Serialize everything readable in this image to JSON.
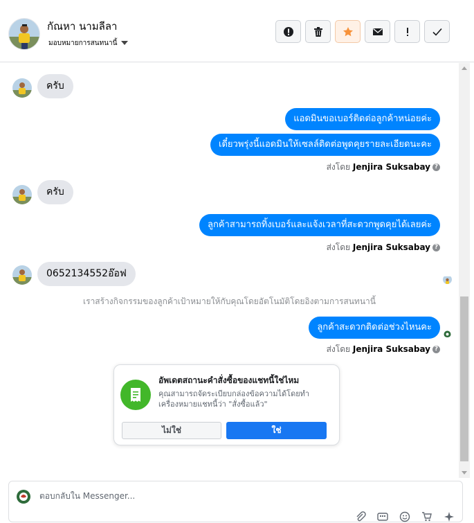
{
  "header": {
    "contact_name": "กัณหา นามลีลา",
    "assign_label": "มอบหมายการสนทนานี้",
    "actions": [
      {
        "icon": "alert-circle-icon",
        "name": "mark-spam-button"
      },
      {
        "icon": "trash-icon",
        "name": "delete-button"
      },
      {
        "icon": "star-icon",
        "name": "star-button"
      },
      {
        "icon": "envelope-icon",
        "name": "mark-unread-button"
      },
      {
        "icon": "exclamation-icon",
        "name": "follow-up-button"
      },
      {
        "icon": "check-icon",
        "name": "mark-done-button"
      }
    ]
  },
  "messages": {
    "in_1": "ครับ",
    "out_1": "แอดมินขอเบอร์ติดต่อลูกค้าหน่อยค่ะ",
    "out_2": "เดี๋ยวพรุ่งนี้แอดมินให้เซลล์ติดต่อพูดคุยรายละเอียดนะคะ",
    "in_2": "ครับ",
    "out_3": "ลูกค้าสามารถทิ้งเบอร์และแจ้งเวลาที่สะดวกพูดคุยได้เลยค่ะ",
    "in_3": "0652134552อ๊อฟ",
    "system_note": "เราสร้างกิจกรรมของลูกค้าเป้าหมายให้กับคุณโดยอัตโนมัติโดยอิงตามการสนทนานี้",
    "out_4": "ลูกค้าสะดวกติดต่อช่วงไหนคะ"
  },
  "sent_by": {
    "prefix": "ส่งโดย",
    "agent": "Jenjira Suksabay"
  },
  "status_card": {
    "title": "อัพเดตสถานะคำสั่งซื้อของแชทนี้ใช่ไหม",
    "body": "คุณสามารถจัดระเบียบกล่องข้อความได้โดยทำเครื่องหมายแชทนี้ว่า \"สั่งซื้อแล้ว\"",
    "no_label": "ไม่ใช่",
    "yes_label": "ใช่"
  },
  "composer": {
    "placeholder": "ตอบกลับใน Messenger..."
  },
  "colors": {
    "outgoing_bubble": "#0084ff",
    "incoming_bubble": "#e4e6eb",
    "primary_button": "#1877f2",
    "star": "#f7923a",
    "order_icon_bg": "#42b72a"
  }
}
